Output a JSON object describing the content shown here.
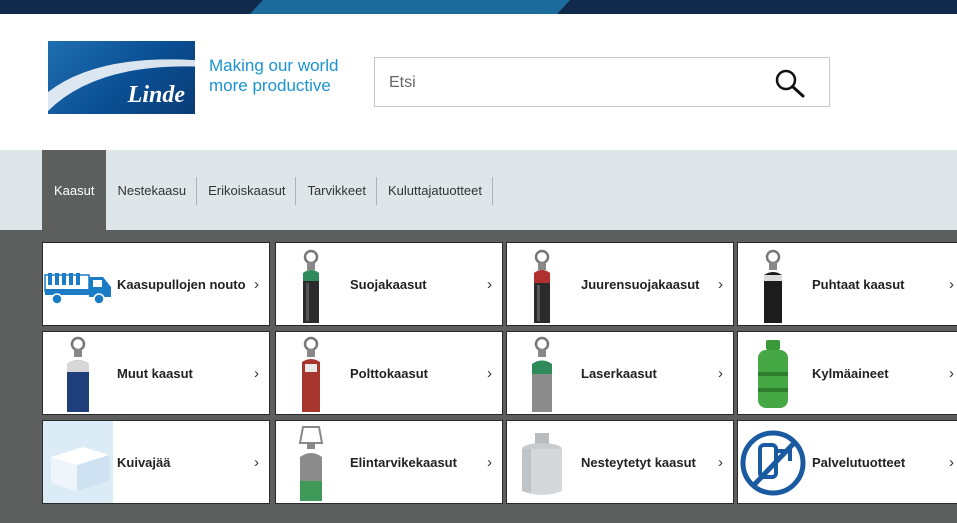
{
  "header": {
    "logo_text": "Linde",
    "tagline_line1": "Making our world",
    "tagline_line2": "more productive"
  },
  "search": {
    "placeholder": "Etsi",
    "icon": "search-icon"
  },
  "nav": {
    "tabs": [
      {
        "label": "Kaasut",
        "active": true
      },
      {
        "label": "Nestekaasu",
        "active": false
      },
      {
        "label": "Erikoiskaasut",
        "active": false
      },
      {
        "label": "Tarvikkeet",
        "active": false
      },
      {
        "label": "Kuluttajatuotteet",
        "active": false
      }
    ]
  },
  "categories": [
    {
      "label": "Kaasupullojen nouto",
      "icon": "truck-with-cylinders-icon",
      "chevron": "›"
    },
    {
      "label": "Suojakaasut",
      "icon": "gas-cylinder-icon",
      "chevron": "›"
    },
    {
      "label": "Juurensuojakaasut",
      "icon": "gas-cylinder-icon",
      "chevron": "›"
    },
    {
      "label": "Puhtaat kaasut",
      "icon": "gas-cylinder-icon",
      "chevron": "›"
    },
    {
      "label": "Muut kaasut",
      "icon": "gas-cylinder-icon",
      "chevron": "›"
    },
    {
      "label": "Polttokaasut",
      "icon": "gas-cylinder-icon",
      "chevron": "›"
    },
    {
      "label": "Laserkaasut",
      "icon": "gas-cylinder-icon",
      "chevron": "›"
    },
    {
      "label": "Kylmäaineet",
      "icon": "refrigerant-bottle-icon",
      "chevron": "›"
    },
    {
      "label": "Kuivajää",
      "icon": "dry-ice-icon",
      "chevron": "›"
    },
    {
      "label": "Elintarvikekaasut",
      "icon": "gas-cylinder-icon",
      "chevron": "›"
    },
    {
      "label": "Nesteytetyt kaasut",
      "icon": "dewar-icon",
      "chevron": "›"
    },
    {
      "label": "Palvelutuotteet",
      "icon": "service-no-icon",
      "chevron": "›"
    }
  ],
  "colors": {
    "brand_blue": "#0a4f93",
    "tagline_blue": "#1b93d1",
    "nav_bg": "#dfe6e9",
    "active_tab": "#5d5e5e",
    "grid_bg": "#5d5e5e"
  }
}
